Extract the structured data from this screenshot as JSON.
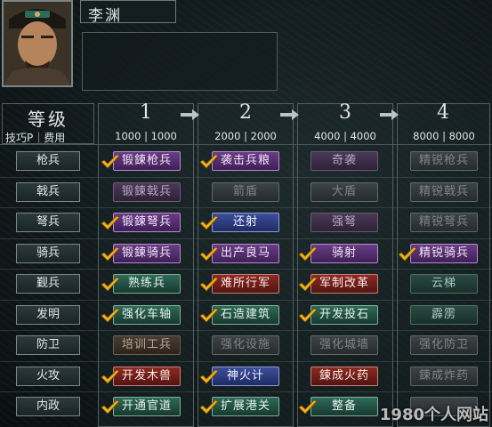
{
  "character": {
    "name": "李渊"
  },
  "header": {
    "title": "等级",
    "subtitle": "技巧P｜费用"
  },
  "levels": [
    {
      "label": "1",
      "cost": "1000 | 1000"
    },
    {
      "label": "2",
      "cost": "2000 | 2000"
    },
    {
      "label": "3",
      "cost": "4000 | 4000"
    },
    {
      "label": "4",
      "cost": "8000 | 8000"
    }
  ],
  "categories": [
    "枪兵",
    "戟兵",
    "弩兵",
    "骑兵",
    "觐兵",
    "发明",
    "防卫",
    "火攻",
    "内政"
  ],
  "skills": [
    [
      {
        "label": "锻鍊枪兵",
        "style": "purple",
        "checked": true
      },
      {
        "label": "袭击兵粮",
        "style": "purple",
        "checked": true
      },
      {
        "label": "奇袭",
        "style": "dimpurple",
        "checked": false
      },
      {
        "label": "精锐枪兵",
        "style": "grey",
        "checked": false
      }
    ],
    [
      {
        "label": "锻鍊戟兵",
        "style": "dimpurple",
        "checked": false
      },
      {
        "label": "箭盾",
        "style": "grey",
        "checked": false
      },
      {
        "label": "大盾",
        "style": "grey",
        "checked": false
      },
      {
        "label": "精锐戟兵",
        "style": "grey",
        "checked": false
      }
    ],
    [
      {
        "label": "锻鍊弩兵",
        "style": "purple",
        "checked": true
      },
      {
        "label": "还射",
        "style": "blue",
        "checked": true
      },
      {
        "label": "强弩",
        "style": "dimpurple",
        "checked": false
      },
      {
        "label": "精锐弩兵",
        "style": "grey",
        "checked": false
      }
    ],
    [
      {
        "label": "锻鍊骑兵",
        "style": "purple",
        "checked": true
      },
      {
        "label": "出产良马",
        "style": "purple",
        "checked": true
      },
      {
        "label": "骑射",
        "style": "purple",
        "checked": true
      },
      {
        "label": "精锐骑兵",
        "style": "purple",
        "checked": true
      }
    ],
    [
      {
        "label": "熟练兵",
        "style": "green",
        "checked": true
      },
      {
        "label": "难所行军",
        "style": "red",
        "checked": true
      },
      {
        "label": "军制改革",
        "style": "red",
        "checked": true
      },
      {
        "label": "云梯",
        "style": "dimgreen",
        "checked": false
      }
    ],
    [
      {
        "label": "强化车轴",
        "style": "green",
        "checked": true
      },
      {
        "label": "石造建筑",
        "style": "green",
        "checked": true
      },
      {
        "label": "开发投石",
        "style": "green",
        "checked": true
      },
      {
        "label": "霹雳",
        "style": "dimgreen",
        "checked": false
      }
    ],
    [
      {
        "label": "培训工兵",
        "style": "dimbrown",
        "checked": false
      },
      {
        "label": "强化设施",
        "style": "grey",
        "checked": false
      },
      {
        "label": "强化城墙",
        "style": "grey",
        "checked": false
      },
      {
        "label": "强化防卫",
        "style": "grey",
        "checked": false
      }
    ],
    [
      {
        "label": "开发木兽",
        "style": "red",
        "checked": true
      },
      {
        "label": "神火计",
        "style": "blue",
        "checked": true
      },
      {
        "label": "鍊成火药",
        "style": "red",
        "checked": false
      },
      {
        "label": "鍊成炸药",
        "style": "grey",
        "checked": false
      }
    ],
    [
      {
        "label": "开通官道",
        "style": "green",
        "checked": true
      },
      {
        "label": "扩展港关",
        "style": "green",
        "checked": true
      },
      {
        "label": "整备",
        "style": "green",
        "checked": true
      },
      {
        "label": "",
        "style": "grey",
        "checked": false
      }
    ]
  ],
  "watermark": "1980个人网站"
}
